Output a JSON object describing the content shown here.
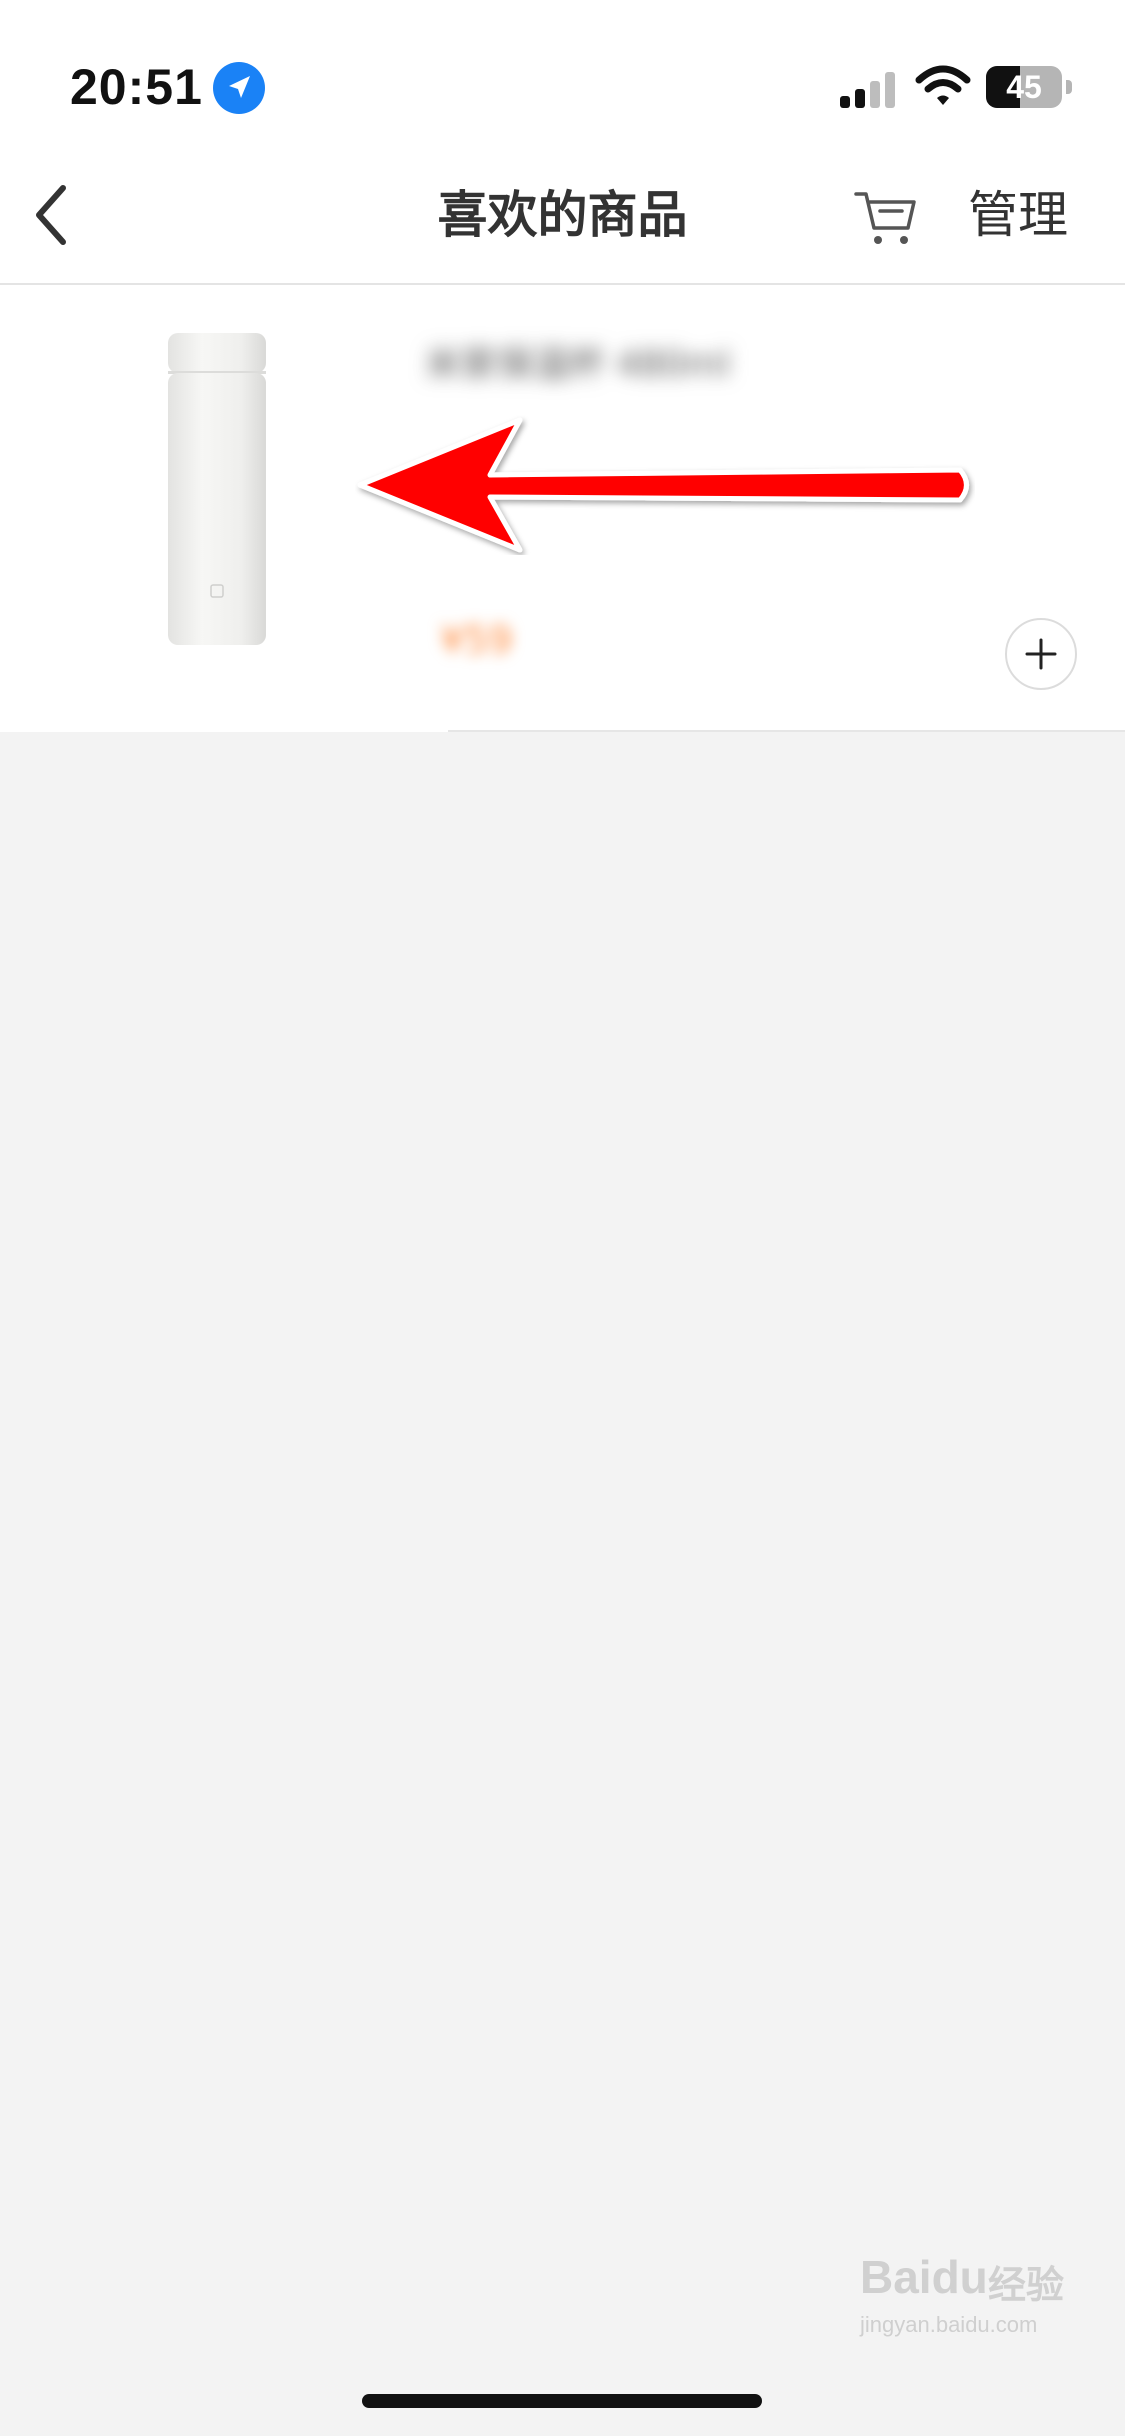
{
  "status_bar": {
    "time": "20:51",
    "battery_level": "45",
    "battery_fraction": 0.45,
    "icons": [
      "location-arrow-icon",
      "cellular-signal-icon",
      "wifi-icon",
      "battery-icon"
    ]
  },
  "nav": {
    "title": "喜欢的商品",
    "manage_label": "管理",
    "icons": [
      "chevron-left-icon",
      "cart-icon"
    ]
  },
  "product": {
    "name": "米家保温杯 480ml",
    "price": "¥59"
  },
  "watermark": {
    "brand": "Baidu",
    "label": "经验",
    "url": "jingyan.baidu.com"
  },
  "colors": {
    "accent_price": "#ff8a3d",
    "annotation_arrow": "#ff0000",
    "location_icon": "#1a82f6",
    "page_background": "#f3f3f3"
  }
}
